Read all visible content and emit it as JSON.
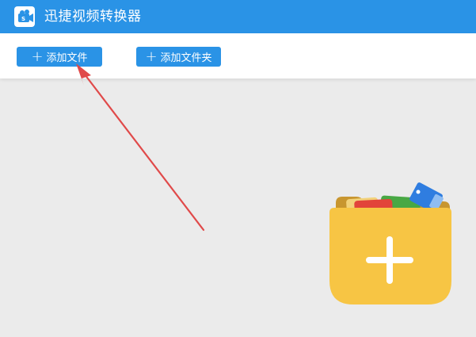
{
  "app": {
    "title": "迅捷视频转换器",
    "brand_color": "#2a93e6"
  },
  "toolbar": {
    "add_file_label": "添加文件",
    "add_folder_label": "添加文件夹",
    "plus_glyph": "+"
  },
  "drop_zone": {
    "icon": "folder-add-icon",
    "folder_color": "#f7c544",
    "plus_color": "#ffffff"
  },
  "annotation": {
    "type": "red-arrow",
    "color": "#e04a4a",
    "points_to": "add-file-button"
  }
}
